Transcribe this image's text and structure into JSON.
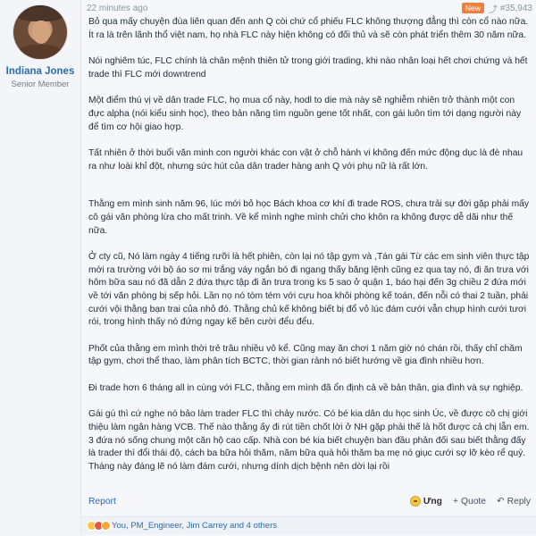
{
  "user": {
    "name": "Indiana Jones",
    "title": "Senior Member"
  },
  "meta": {
    "time": "22 minutes ago",
    "badge": "New",
    "share_icon": "share-icon",
    "post_number": "#35,943"
  },
  "paragraphs": [
    "Bỏ qua mấy chuyện đùa liên quan đến anh Q còi chứ cổ phiếu FLC không thượng đẳng thì còn cổ nào nữa. Ít ra là trên lãnh thổ việt nam, họ nhà FLC này hiện không có đối thủ và sẽ còn phát triển thêm 30 năm nữa.",
    "Nói nghiêm túc, FLC chính là chân mệnh thiên tử trong giới trading, khi nào nhân loại hết chơi chứng và hết trade thì FLC mới downtrend",
    "Một điểm thú vị về dân trade FLC, họ mua cổ này, hodl to die mà này sẽ nghiễm nhiên trở thành một con đực alpha (nói kiểu sinh học), theo bản năng tìm nguồn gene tốt nhất, con gái luôn tìm tới dạng người này để tìm cơ hội giao hợp.",
    "Tất nhiên ở thời buổi văn minh con người khác con vật ở chỗ hành vi không đến mức động dục là đè nhau ra như loài khỉ đột, nhưng sức hút của dân trader hàng anh Q với phụ nữ là rất lớn.",
    "Thằng em mình sinh năm 96, lúc mới bỏ học Bách khoa cơ khí đi trade ROS, chưa trải sự đời gặp phải mấy cô gái văn phòng lừa cho mất trinh. Về kể mình nghe mình chửi cho khôn ra không được dễ dãi như thế nữa.",
    "Ở cty cũ, Nó làm ngày 4 tiếng rưỡi là hết phiên, còn lại nó tập gym và ,Tán gái Từ các em sinh viên thực tập mới ra trường với bộ áo sơ mi trắng váy ngắn bó đi ngang thấy băng lệnh cũng ez qua tay nó, đi ăn trưa với hôm bữa sau nó đã dẫn 2 đứa thực tập đi ăn trưa trong ks 5 sao ở quận 1, báo hại đến 3g chiều 2 đứa mới về tới văn phòng bị sếp hỏi. Lần nọ nó tòm tém với cựu hoa khôi phòng kế toán, đến nỗi có thai 2 tuần, phải cưới vội thằng bạn trai của nhỏ đó. Thằng chủ kế không biết bị đổ vỏ lúc đám cưới vẫn chụp hình cưới tươi rói, trong hình thấy nó đứng ngay kế bên cười đểu đểu.",
    "Phốt của thằng em mình thời trẻ trâu nhiều vô kể. Cũng may ăn chơi 1 năm giờ nó chán rồi, thấy chỉ chăm tập gym, chơi thể thao, làm phân tích BCTC, thời gian rảnh nó biết hướng về gia đình nhiều hơn.",
    "Đi trade hơn 6 tháng all in cùng với FLC, thằng em mình đã ổn định cả về bản thân, gia đình và sự nghiệp.",
    "Gái gú thì cứ nghe nó bảo làm trader FLC thì chảy nước. Có bé kia dân du học sinh Úc, về được cô chị giới thiệu làm ngân hàng VCB. Thế nào thằng ấy đi rút tiền chốt lời ở NH gặp phải thế là hốt được cả chị lẫn em. 3 đứa nó sống chung một căn hộ cao cấp. Nhà con bé kia biết chuyện ban đầu phản đối sau biết thằng đấy là trader thì đổi thái độ, cách ba bữa hỏi thăm, năm bữa quà hỏi thăm ba mẹ nó giục cưới sợ lỡ kèo rể quý. Tháng này đáng lẽ nó làm đám cưới, nhưng dính dịch bệnh nên dời lại rồi"
  ],
  "footer": {
    "report": "Report",
    "like": "Ưng",
    "quote": "Quote",
    "reply": "Reply"
  },
  "reactions": {
    "text": "You, PM_Engineer, Jim Carrey and 4 others"
  }
}
